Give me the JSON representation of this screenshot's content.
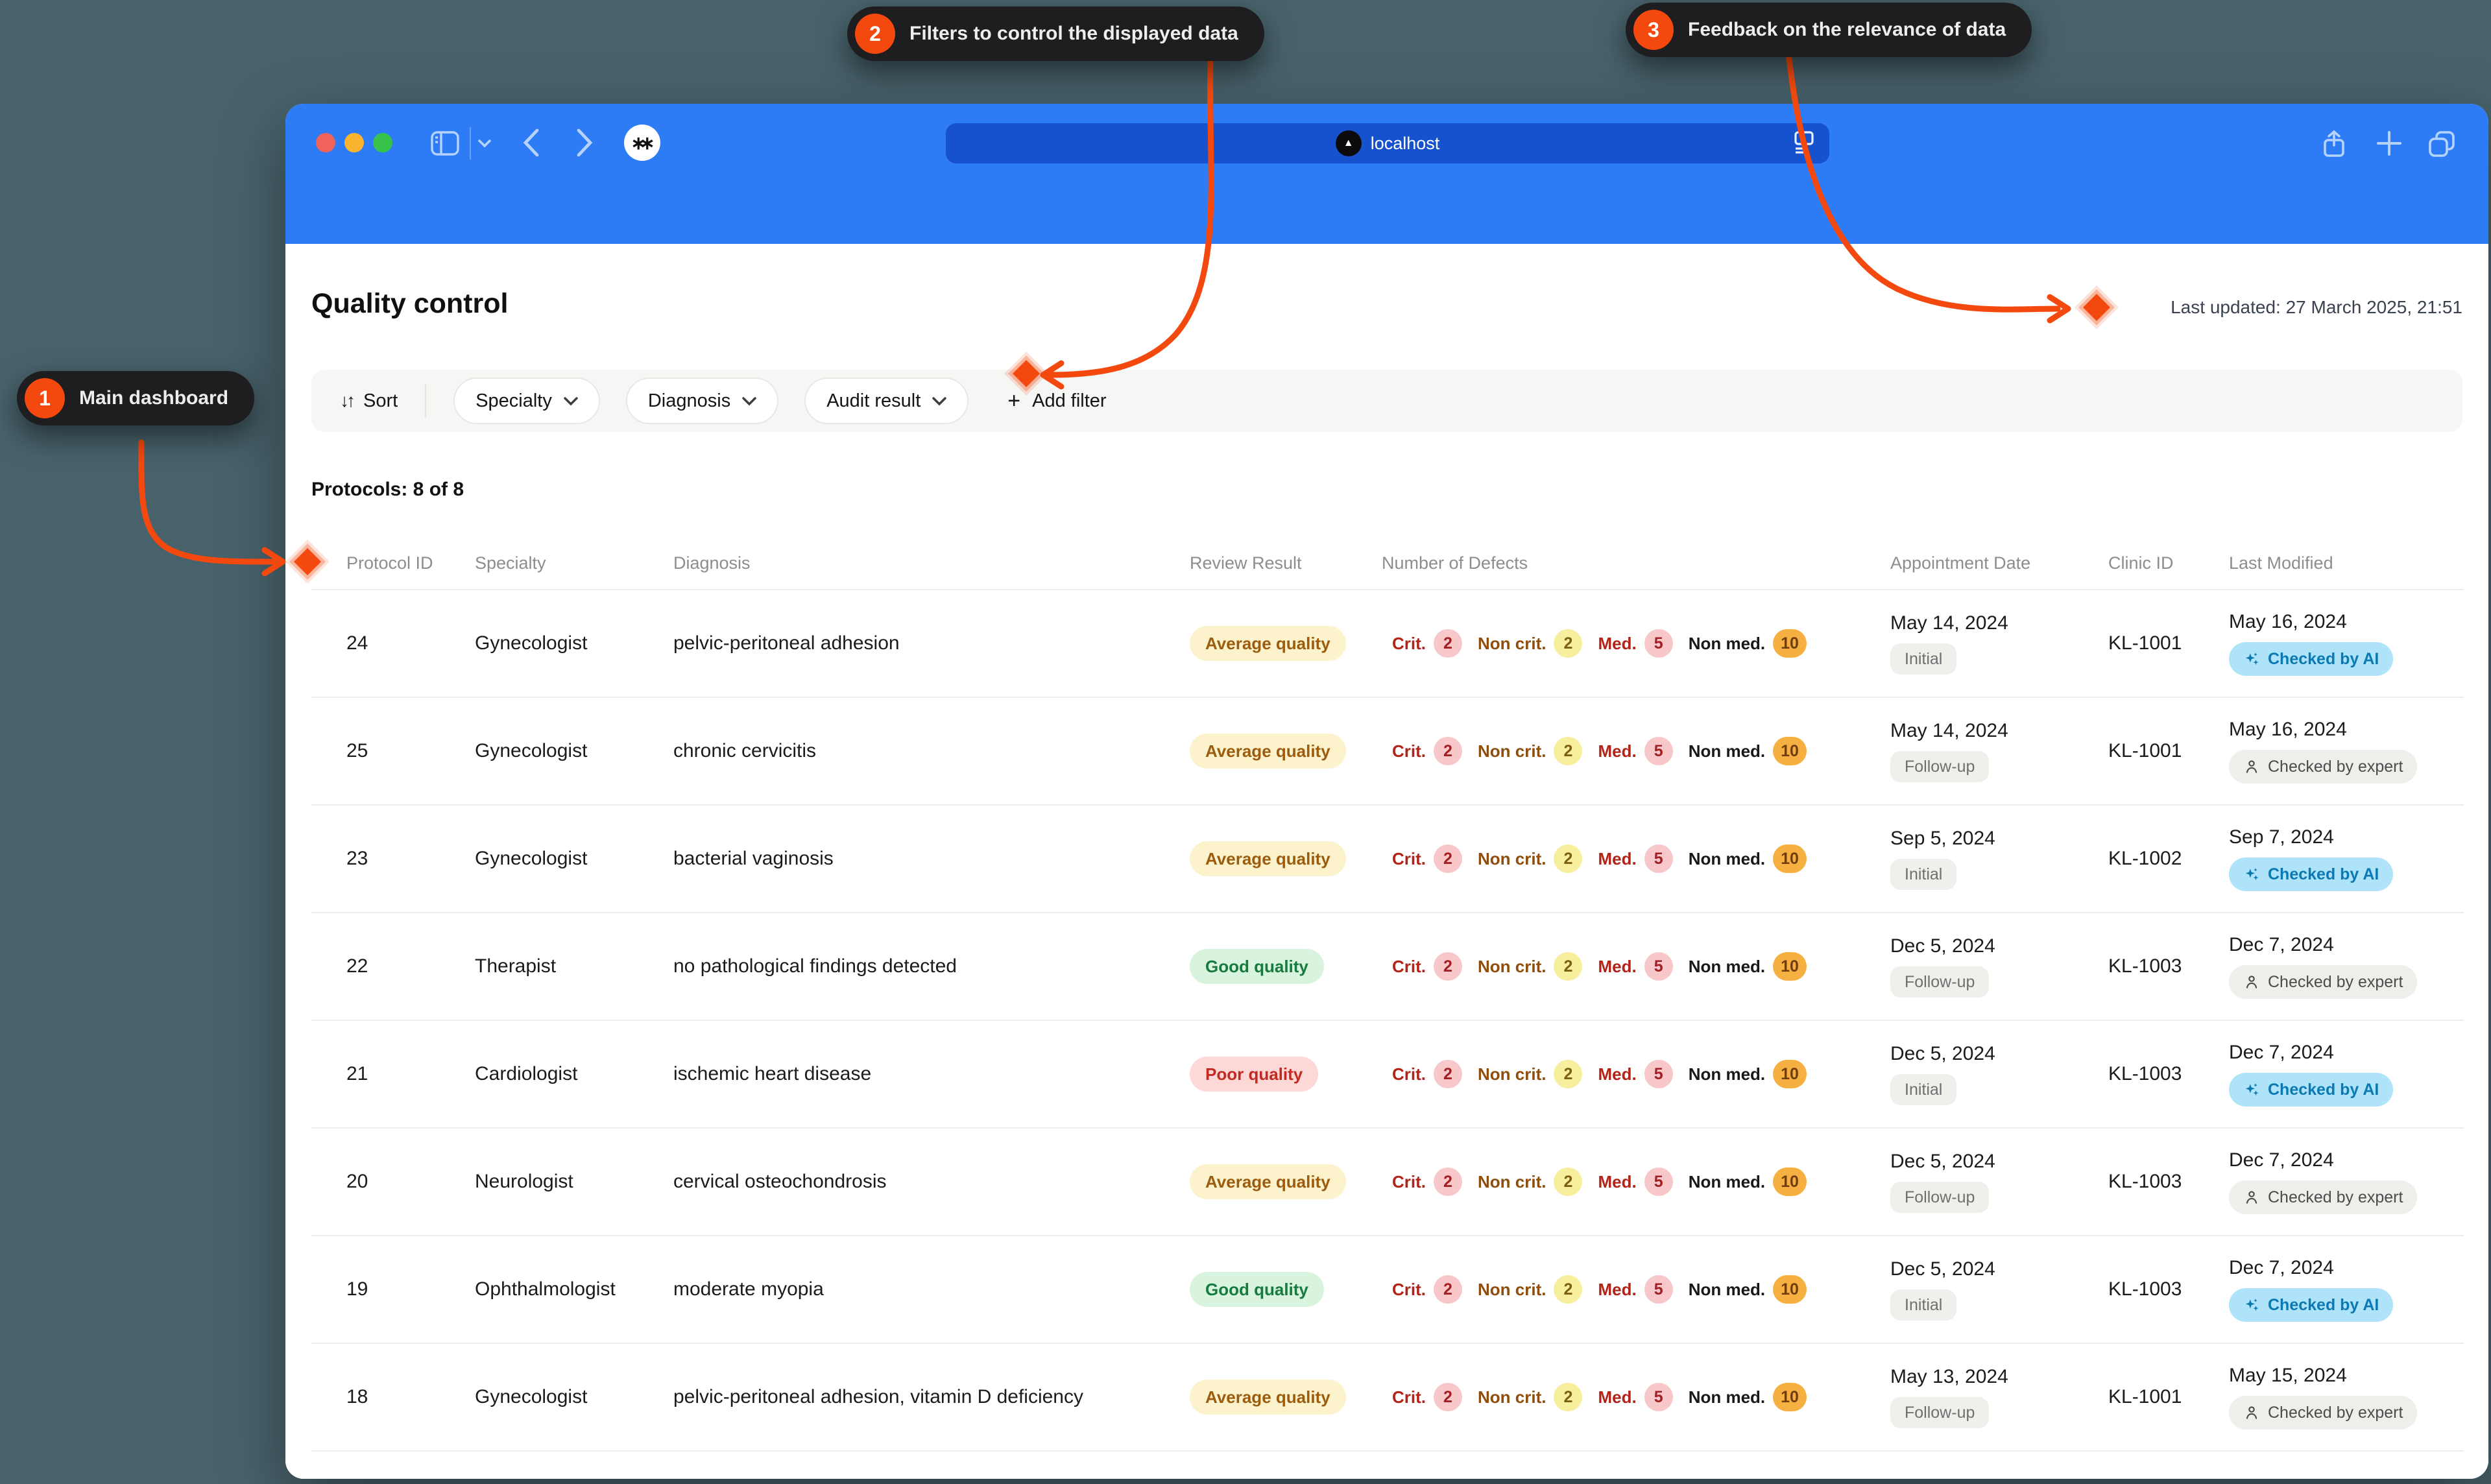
{
  "colors": {
    "accent_orange": "#f4490e",
    "callout_bg": "#1e1e20",
    "desktop_bg": "#48626b",
    "chrome_blue": "#2e7bf6",
    "urlbar_blue": "#1652ce",
    "quality_average_bg": "#fcf3cd",
    "quality_average_text": "#9c5c0f",
    "quality_good_bg": "#d9f4de",
    "quality_good_text": "#177a3e",
    "quality_poor_bg": "#fcd9d7",
    "quality_poor_text": "#c22a22",
    "checked_ai_bg": "#aee3fa",
    "checked_ai_text": "#0c7ab2",
    "checked_expert_bg": "#eeeeeb",
    "checked_expert_text": "#4c4c4c"
  },
  "callouts": [
    {
      "number": "1",
      "label": "Main dashboard"
    },
    {
      "number": "2",
      "label": "Filters to control the displayed data"
    },
    {
      "number": "3",
      "label": "Feedback on the relevance of data"
    }
  ],
  "browser": {
    "url": "localhost"
  },
  "page": {
    "title": "Quality control",
    "last_updated": "Last updated: 27 March 2025, 21:51",
    "filters": {
      "sort_label": "Sort",
      "dropdowns": [
        "Specialty",
        "Diagnosis",
        "Audit result"
      ],
      "add_filter_label": "Add filter"
    },
    "protocols_count": "Protocols: 8 of 8",
    "table": {
      "columns": [
        "Protocol ID",
        "Specialty",
        "Diagnosis",
        "Review Result",
        "Number of Defects",
        "Appointment Date",
        "Clinic ID",
        "Last Modified"
      ],
      "defects_meta": [
        {
          "label": "Crit.",
          "label_style": "red",
          "badge_style": "pink"
        },
        {
          "label": "Non crit.",
          "label_style": "brown",
          "badge_style": "yellow"
        },
        {
          "label": "Med.",
          "label_style": "red",
          "badge_style": "pink"
        },
        {
          "label": "Non med.",
          "label_style": "dark",
          "badge_style": "orange"
        }
      ],
      "rows": [
        {
          "id": "24",
          "specialty": "Gynecologist",
          "diagnosis": "pelvic-peritoneal adhesion",
          "review": "Average quality",
          "review_type": "average",
          "defects": [
            "2",
            "2",
            "5",
            "10"
          ],
          "appointment_date": "May 14, 2024",
          "appointment_type": "Initial",
          "clinic_id": "KL-1001",
          "modified": "May 16, 2024",
          "checked_by": "Checked by AI",
          "checked_type": "ai"
        },
        {
          "id": "25",
          "specialty": "Gynecologist",
          "diagnosis": "chronic cervicitis",
          "review": "Average quality",
          "review_type": "average",
          "defects": [
            "2",
            "2",
            "5",
            "10"
          ],
          "appointment_date": "May 14, 2024",
          "appointment_type": "Follow-up",
          "clinic_id": "KL-1001",
          "modified": "May 16, 2024",
          "checked_by": "Checked by expert",
          "checked_type": "expert"
        },
        {
          "id": "23",
          "specialty": "Gynecologist",
          "diagnosis": "bacterial vaginosis",
          "review": "Average quality",
          "review_type": "average",
          "defects": [
            "2",
            "2",
            "5",
            "10"
          ],
          "appointment_date": "Sep 5, 2024",
          "appointment_type": "Initial",
          "clinic_id": "KL-1002",
          "modified": "Sep 7, 2024",
          "checked_by": "Checked by AI",
          "checked_type": "ai"
        },
        {
          "id": "22",
          "specialty": "Therapist",
          "diagnosis": "no pathological findings detected",
          "review": "Good quality",
          "review_type": "good",
          "defects": [
            "2",
            "2",
            "5",
            "10"
          ],
          "appointment_date": "Dec 5, 2024",
          "appointment_type": "Follow-up",
          "clinic_id": "KL-1003",
          "modified": "Dec 7, 2024",
          "checked_by": "Checked by expert",
          "checked_type": "expert"
        },
        {
          "id": "21",
          "specialty": "Cardiologist",
          "diagnosis": "ischemic heart disease",
          "review": "Poor quality",
          "review_type": "poor",
          "defects": [
            "2",
            "2",
            "5",
            "10"
          ],
          "appointment_date": "Dec 5, 2024",
          "appointment_type": "Initial",
          "clinic_id": "KL-1003",
          "modified": "Dec 7, 2024",
          "checked_by": "Checked by AI",
          "checked_type": "ai"
        },
        {
          "id": "20",
          "specialty": "Neurologist",
          "diagnosis": "cervical osteochondrosis",
          "review": "Average quality",
          "review_type": "average",
          "defects": [
            "2",
            "2",
            "5",
            "10"
          ],
          "appointment_date": "Dec 5, 2024",
          "appointment_type": "Follow-up",
          "clinic_id": "KL-1003",
          "modified": "Dec 7, 2024",
          "checked_by": "Checked by expert",
          "checked_type": "expert"
        },
        {
          "id": "19",
          "specialty": "Ophthalmologist",
          "diagnosis": "moderate myopia",
          "review": "Good quality",
          "review_type": "good",
          "defects": [
            "2",
            "2",
            "5",
            "10"
          ],
          "appointment_date": "Dec 5, 2024",
          "appointment_type": "Initial",
          "clinic_id": "KL-1003",
          "modified": "Dec 7, 2024",
          "checked_by": "Checked by AI",
          "checked_type": "ai"
        },
        {
          "id": "18",
          "specialty": "Gynecologist",
          "diagnosis": "pelvic-peritoneal adhesion, vitamin D deficiency",
          "review": "Average quality",
          "review_type": "average",
          "defects": [
            "2",
            "2",
            "5",
            "10"
          ],
          "appointment_date": "May 13, 2024",
          "appointment_type": "Follow-up",
          "clinic_id": "KL-1001",
          "modified": "May 15, 2024",
          "checked_by": "Checked by expert",
          "checked_type": "expert"
        }
      ]
    }
  }
}
